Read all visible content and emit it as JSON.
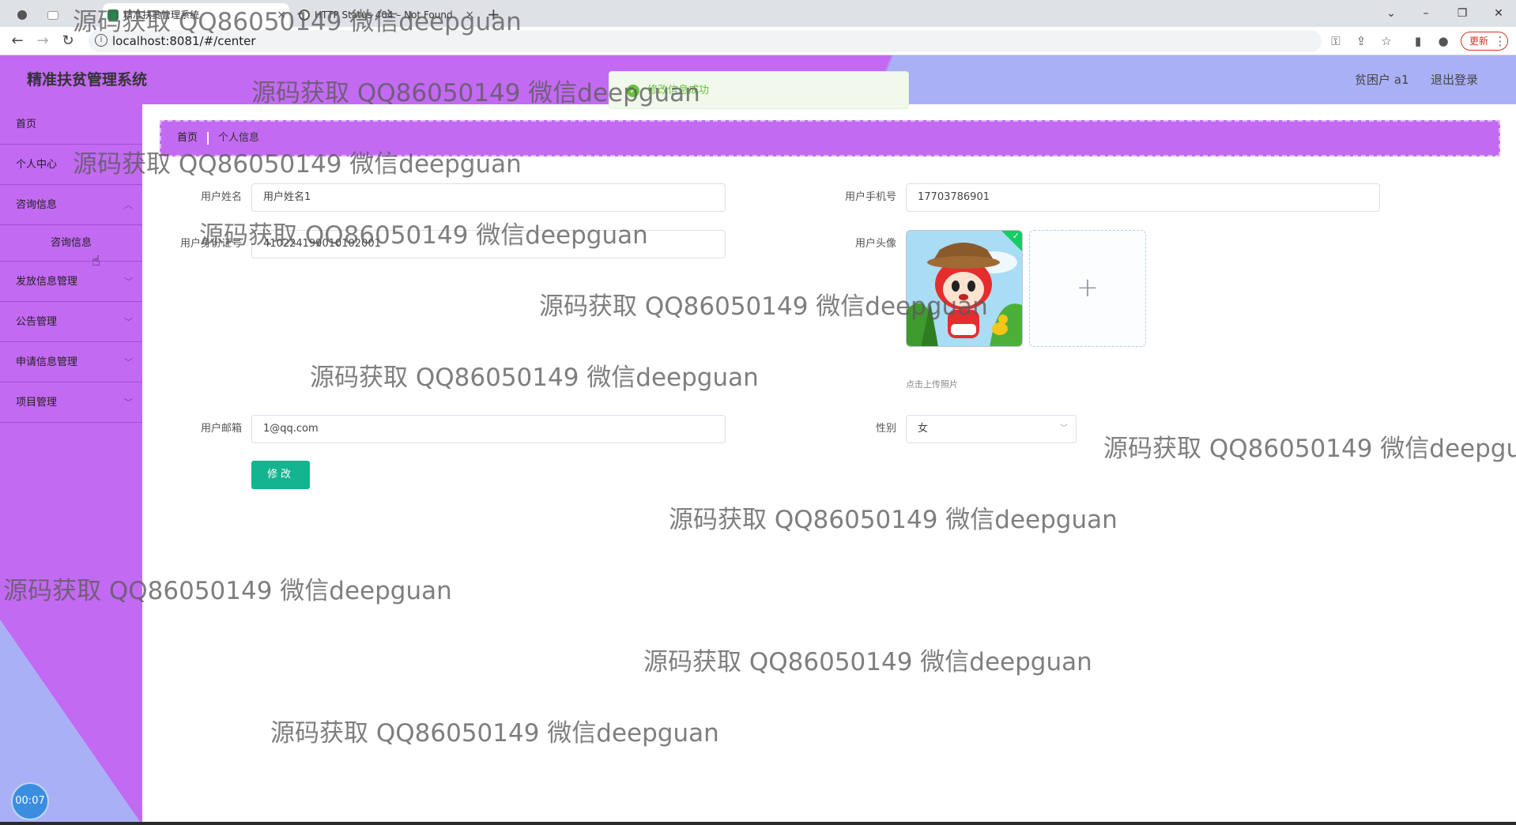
{
  "browser": {
    "tabs": [
      {
        "title": "精准扶贫管理系统"
      },
      {
        "title": "HTTP Status 404 – Not Found"
      }
    ],
    "new_tab": "+",
    "url": "localhost:8081/#/center",
    "update_label": "更新"
  },
  "app": {
    "title": "精准扶贫管理系统",
    "user_label": "贫困户 a1",
    "logout_label": "退出登录"
  },
  "toast": {
    "message": "修改信息成功"
  },
  "sidebar": {
    "items": [
      {
        "label": "首页"
      },
      {
        "label": "个人中心"
      },
      {
        "label": "咨询信息"
      },
      {
        "label": "发放信息管理"
      },
      {
        "label": "公告管理"
      },
      {
        "label": "申请信息管理"
      },
      {
        "label": "项目管理"
      }
    ],
    "submenu_label": "咨询信息",
    "timer": "00:07"
  },
  "breadcrumb": {
    "home": "首页",
    "current": "个人信息"
  },
  "form": {
    "name_label": "用户姓名",
    "name_value": "用户姓名1",
    "phone_label": "用户手机号",
    "phone_value": "17703786901",
    "idcard_label": "用户身份证号",
    "idcard_value": "410224199010102001",
    "avatar_label": "用户头像",
    "upload_hint": "点击上传照片",
    "email_label": "用户邮箱",
    "email_value": "1@qq.com",
    "gender_label": "性别",
    "gender_value": "女",
    "submit_label": "修改"
  },
  "watermark_text": "源码获取 QQ86050149 微信deepguan"
}
